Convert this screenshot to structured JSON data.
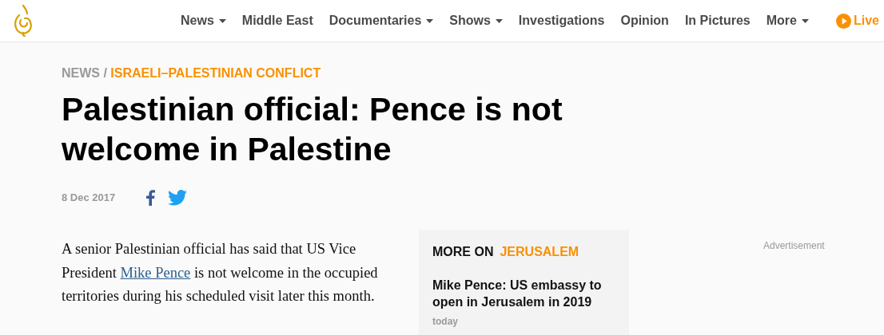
{
  "nav": {
    "items": [
      {
        "label": "News",
        "has_menu": true
      },
      {
        "label": "Middle East",
        "has_menu": false
      },
      {
        "label": "Documentaries",
        "has_menu": true
      },
      {
        "label": "Shows",
        "has_menu": true
      },
      {
        "label": "Investigations",
        "has_menu": false
      },
      {
        "label": "Opinion",
        "has_menu": false
      },
      {
        "label": "In Pictures",
        "has_menu": false
      },
      {
        "label": "More",
        "has_menu": true
      }
    ],
    "live": "Live"
  },
  "breadcrumb": {
    "section": "NEWS",
    "separator": "/",
    "topic": "ISRAELI–PALESTINIAN CONFLICT"
  },
  "headline": "Palestinian official: Pence is not welcome in Palestine",
  "date": "8 Dec 2017",
  "body": {
    "before": "A senior Palestinian official has said that US Vice President ",
    "link": "Mike Pence",
    "after": " is not welcome in the occupied territories during his scheduled visit later this month."
  },
  "more_on": {
    "label": "MORE ON",
    "topic": "JERUSALEM",
    "stories": [
      {
        "title": "Mike Pence: US embassy to open in Jerusalem in 2019",
        "time": "today"
      }
    ]
  },
  "advertisement": "Advertisement"
}
